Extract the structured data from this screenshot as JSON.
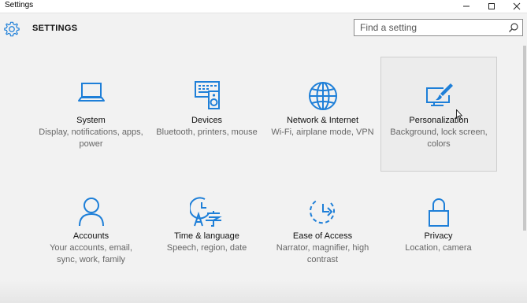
{
  "window": {
    "title": "Settings",
    "controls": [
      "minimize",
      "maximize",
      "close"
    ]
  },
  "header": {
    "title": "SETTINGS",
    "search_placeholder": "Find a setting",
    "search_value": ""
  },
  "colors": {
    "accent": "#1e7fd8",
    "background": "#f2f2f2"
  },
  "tiles": [
    {
      "icon": "laptop-icon",
      "title": "System",
      "desc": "Display, notifications, apps, power"
    },
    {
      "icon": "devices-icon",
      "title": "Devices",
      "desc": "Bluetooth, printers, mouse"
    },
    {
      "icon": "globe-icon",
      "title": "Network & Internet",
      "desc": "Wi-Fi, airplane mode, VPN"
    },
    {
      "icon": "paint-brush-icon",
      "title": "Personalization",
      "desc": "Background, lock screen, colors"
    },
    {
      "icon": "person-icon",
      "title": "Accounts",
      "desc": "Your accounts, email, sync, work, family"
    },
    {
      "icon": "time-language-icon",
      "title": "Time & language",
      "desc": "Speech, region, date"
    },
    {
      "icon": "ease-of-access-icon",
      "title": "Ease of Access",
      "desc": "Narrator, magnifier, high contrast"
    },
    {
      "icon": "lock-icon",
      "title": "Privacy",
      "desc": "Location, camera"
    }
  ],
  "selected_tile": "Personalization"
}
